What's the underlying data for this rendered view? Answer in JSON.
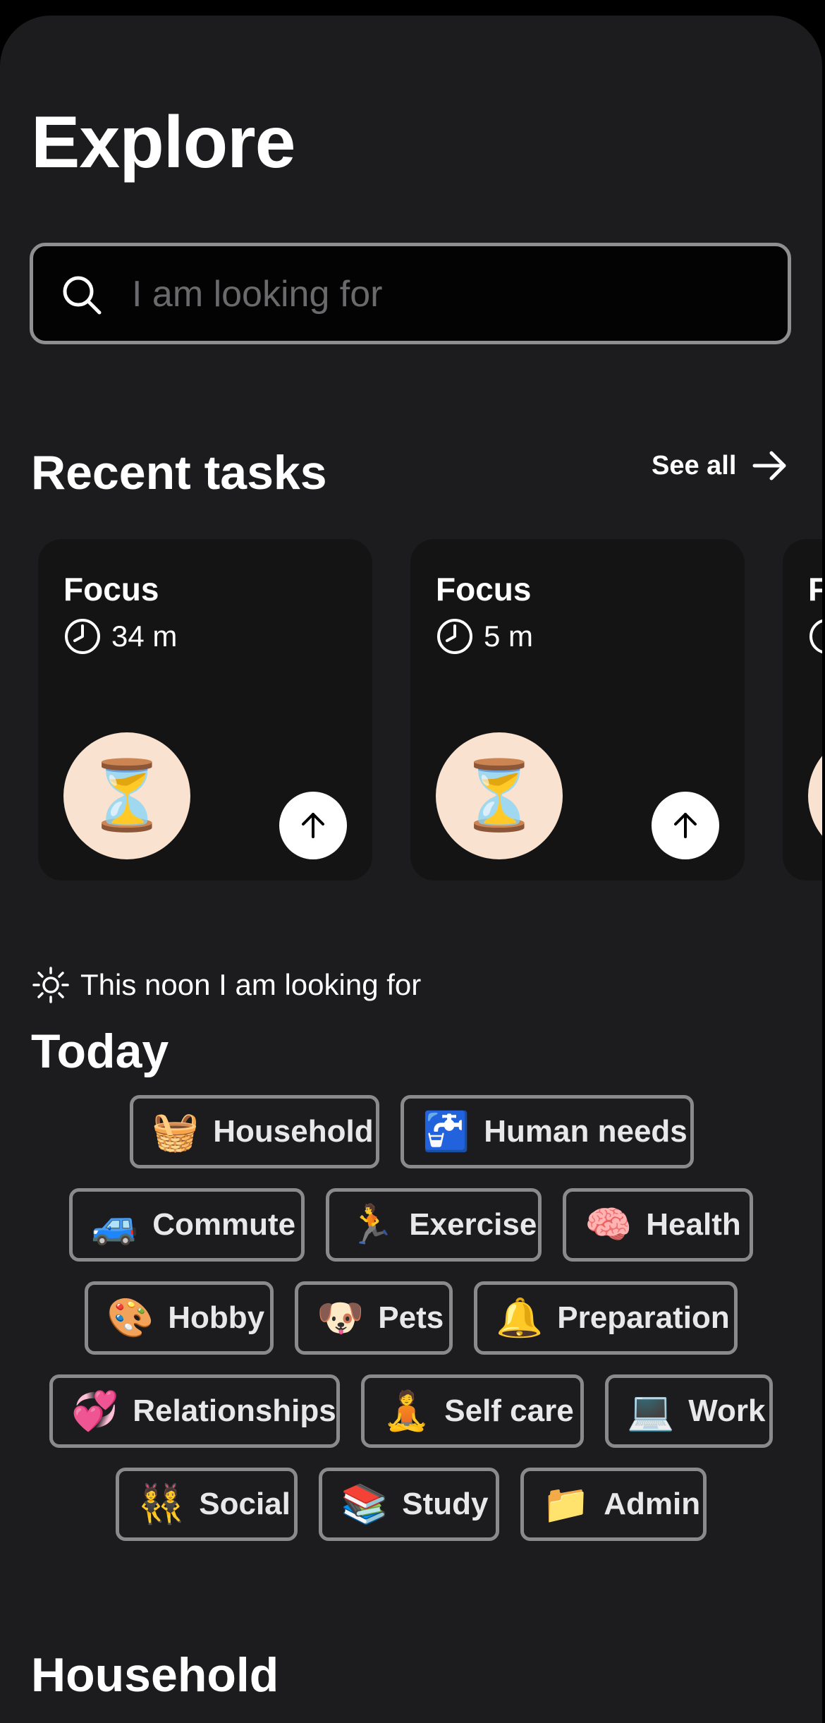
{
  "header": {
    "title": "Explore"
  },
  "search": {
    "placeholder": "I am looking for",
    "icon": "search-icon"
  },
  "recent": {
    "title": "Recent tasks",
    "see_all": "See all",
    "cards": [
      {
        "title": "Focus",
        "duration": "34 m",
        "emoji": "⏳"
      },
      {
        "title": "Focus",
        "duration": "5 m",
        "emoji": "⏳"
      },
      {
        "title": "F",
        "duration": "",
        "emoji": "⏳"
      }
    ]
  },
  "today": {
    "greeting": "This noon I am looking for",
    "title": "Today",
    "categories": [
      {
        "emoji": "🧺",
        "label": "Household"
      },
      {
        "emoji": "🚰",
        "label": "Human needs"
      },
      {
        "emoji": "🚙",
        "label": "Commute"
      },
      {
        "emoji": "🏃",
        "label": "Exercise"
      },
      {
        "emoji": "🧠",
        "label": "Health"
      },
      {
        "emoji": "🎨",
        "label": "Hobby"
      },
      {
        "emoji": "🐶",
        "label": "Pets"
      },
      {
        "emoji": "🔔",
        "label": "Preparation"
      },
      {
        "emoji": "💞",
        "label": "Relationships"
      },
      {
        "emoji": "🧘",
        "label": "Self care"
      },
      {
        "emoji": "💻",
        "label": "Work"
      },
      {
        "emoji": "👯",
        "label": "Social"
      },
      {
        "emoji": "📚",
        "label": "Study"
      },
      {
        "emoji": "📁",
        "label": "Admin"
      }
    ]
  },
  "household_section": {
    "title": "Household"
  },
  "colors": {
    "background": "#1c1c1e",
    "card": "#141414",
    "chip_border": "#8a8a8d",
    "bubble": "#f9e3d0"
  }
}
